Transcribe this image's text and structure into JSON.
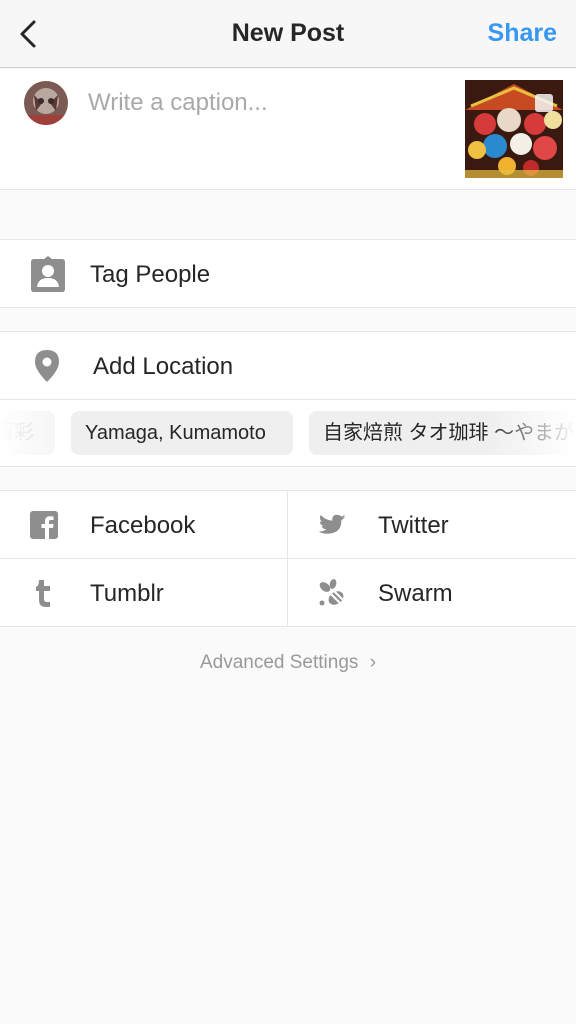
{
  "nav": {
    "title": "New Post",
    "share_label": "Share",
    "accent_color": "#3897f0",
    "back_icon": "chevron-left-icon"
  },
  "caption": {
    "placeholder": "Write a caption..."
  },
  "rows": {
    "tag_people": {
      "label": "Tag People",
      "icon": "tag-person-icon"
    },
    "add_location": {
      "label": "Add Location",
      "icon": "location-pin-icon"
    }
  },
  "location_suggestions": [
    "百彩",
    "Yamaga, Kumamoto",
    "自家焙煎 タオ珈琲 ～やまが～"
  ],
  "share_targets": [
    {
      "label": "Facebook",
      "icon": "facebook-icon"
    },
    {
      "label": "Twitter",
      "icon": "twitter-icon"
    },
    {
      "label": "Tumblr",
      "icon": "tumblr-icon"
    },
    {
      "label": "Swarm",
      "icon": "swarm-icon"
    }
  ],
  "advanced_settings": {
    "label": "Advanced Settings",
    "chevron": "›"
  }
}
